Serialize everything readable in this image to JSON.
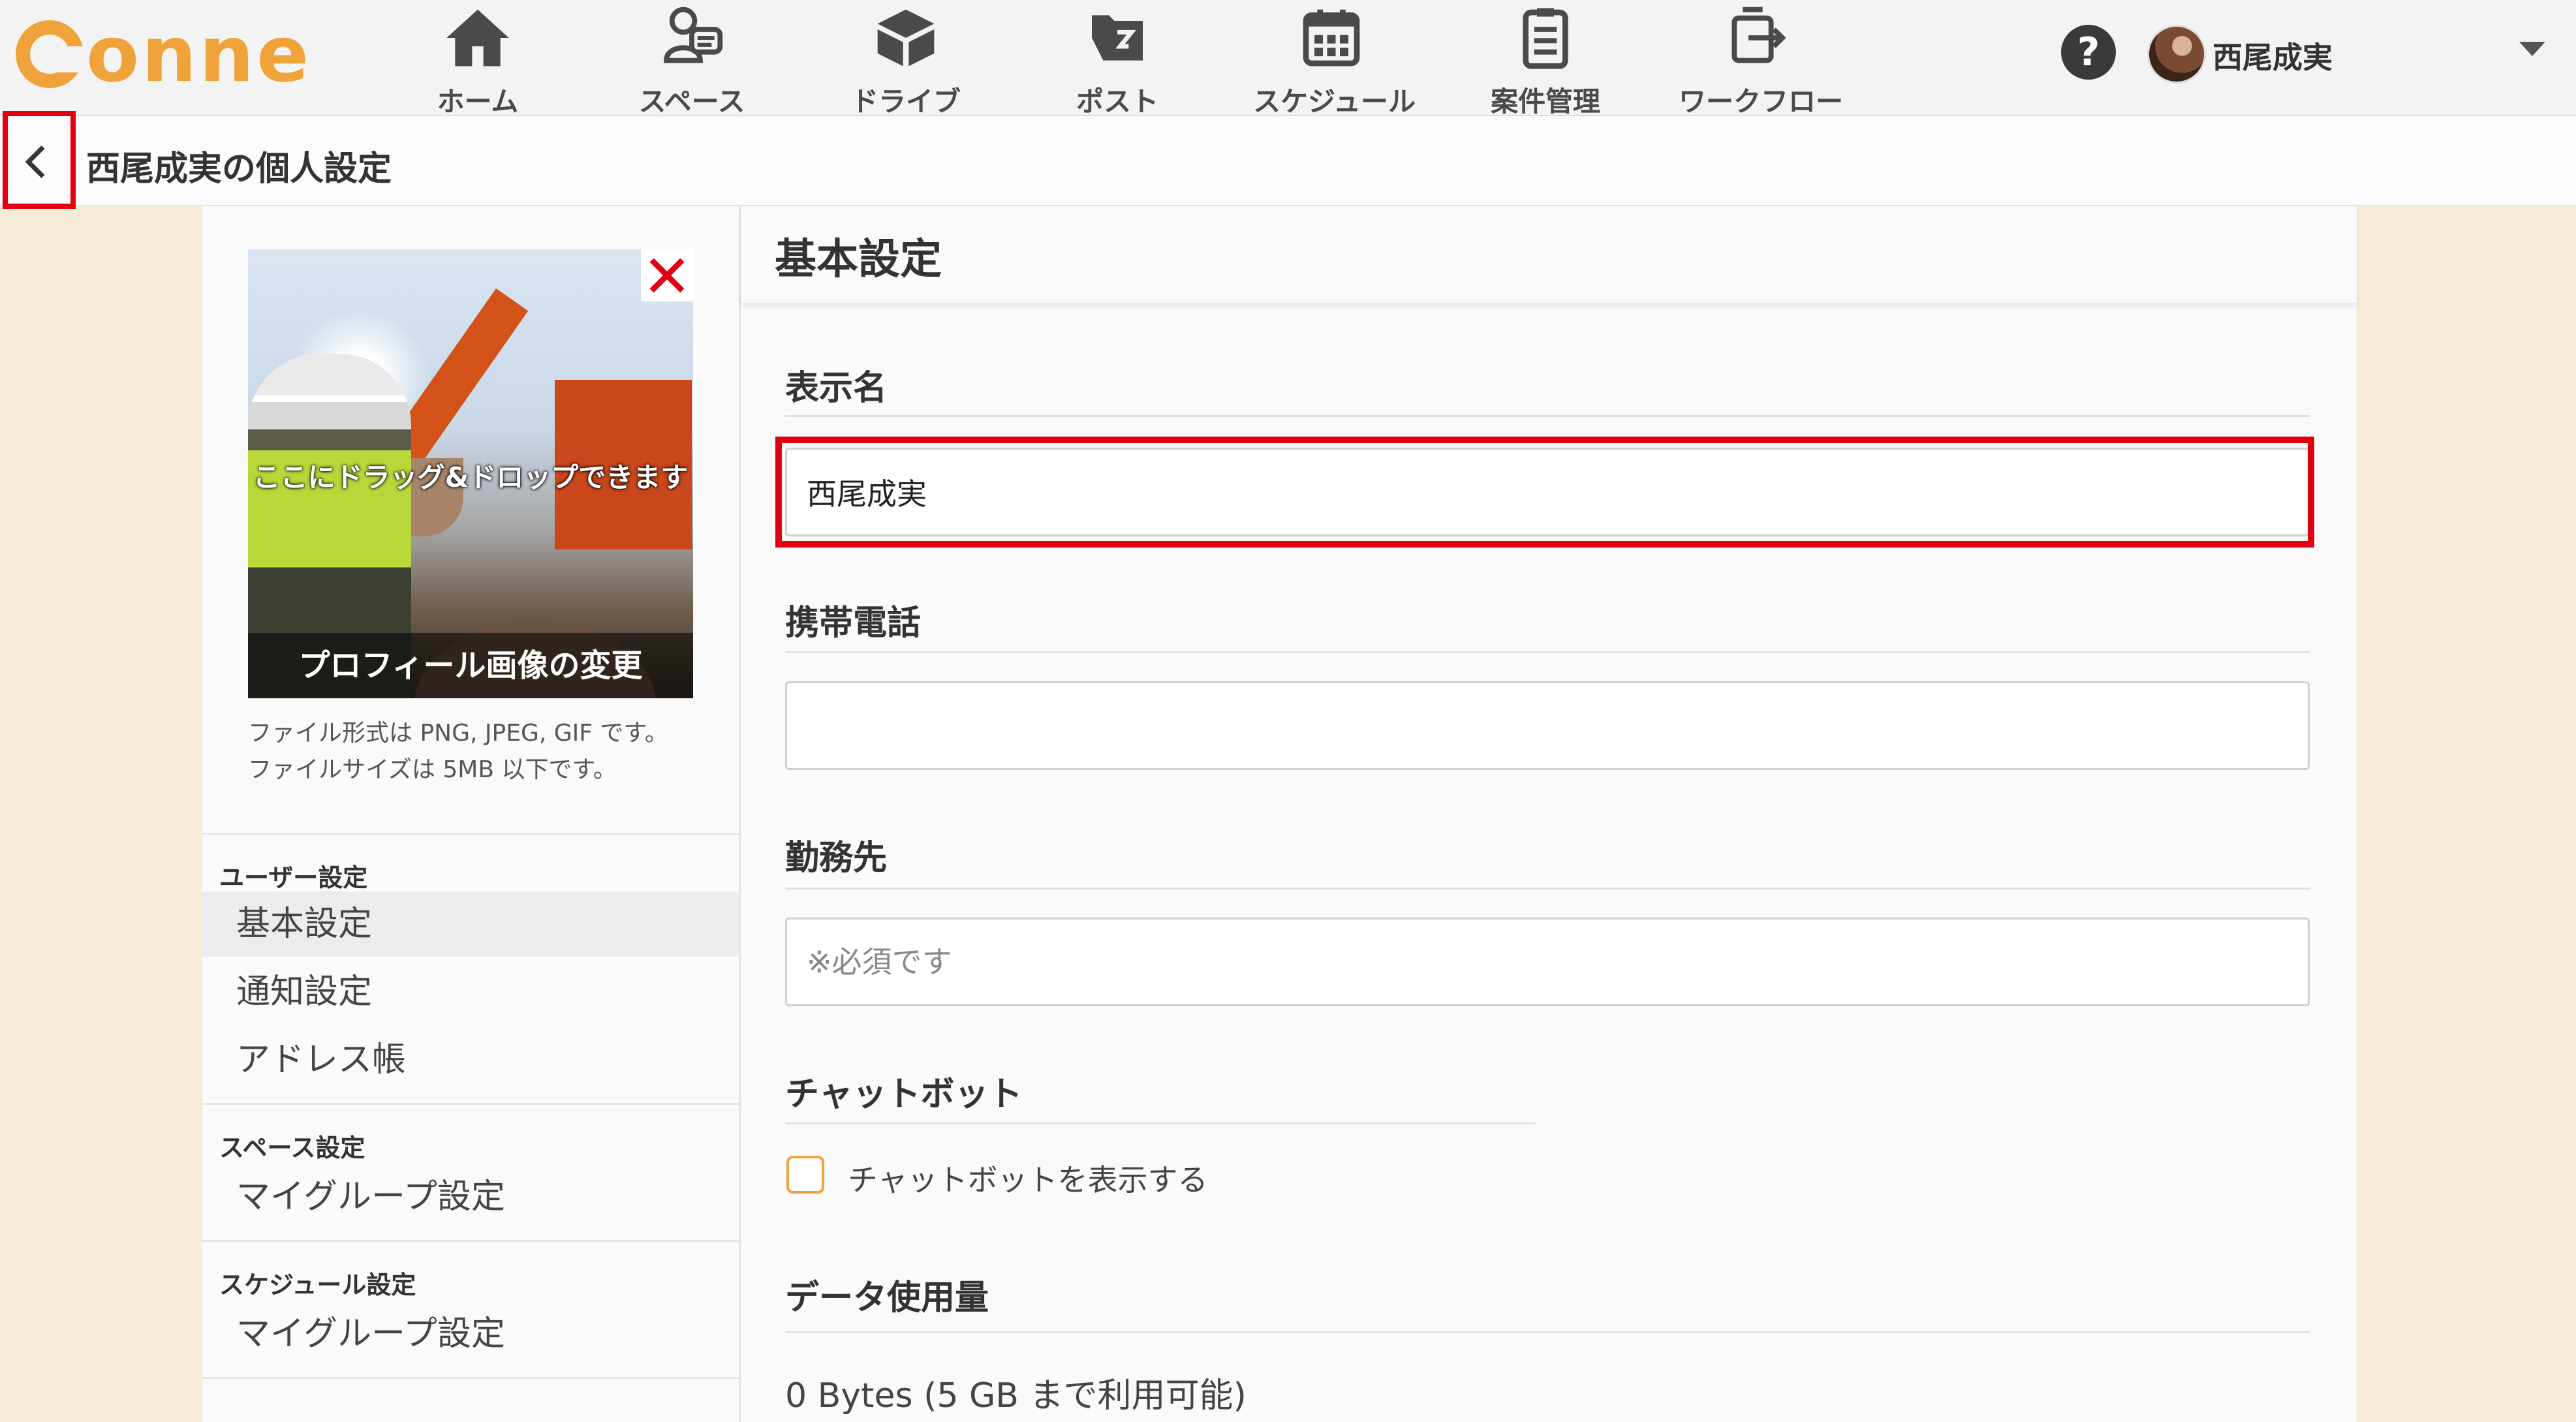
{
  "app": {
    "logo_text": "onne"
  },
  "nav": [
    {
      "label": "ホーム",
      "icon": "home-icon"
    },
    {
      "label": "スペース",
      "icon": "space-icon"
    },
    {
      "label": "ドライブ",
      "icon": "drive-icon"
    },
    {
      "label": "ポスト",
      "icon": "post-icon"
    },
    {
      "label": "スケジュール",
      "icon": "calendar-icon"
    },
    {
      "label": "案件管理",
      "icon": "clipboard-icon"
    },
    {
      "label": "ワークフロー",
      "icon": "workflow-icon"
    }
  ],
  "header": {
    "help_label": "?",
    "user_name": "西尾成実"
  },
  "page": {
    "title": "西尾成実の個人設定"
  },
  "profile": {
    "drop_hint": "ここにドラッグ&ドロップできます",
    "change_label": "プロフィール画像の変更",
    "file_note_1": "ファイル形式は PNG, JPEG, GIF です。",
    "file_note_2": "ファイルサイズは 5MB 以下です。"
  },
  "sidebar": {
    "user_section": "ユーザー設定",
    "user_items": [
      "基本設定",
      "通知設定",
      "アドレス帳"
    ],
    "space_section": "スペース設定",
    "space_items": [
      "マイグループ設定"
    ],
    "schedule_section": "スケジュール設定",
    "schedule_items": [
      "マイグループ設定"
    ]
  },
  "main": {
    "section_title": "基本設定",
    "display_name": {
      "label": "表示名",
      "value": "西尾成実"
    },
    "mobile_phone": {
      "label": "携帯電話",
      "value": ""
    },
    "workplace": {
      "label": "勤務先",
      "placeholder": "※必須です"
    },
    "chatbot": {
      "label": "チャットボット",
      "checkbox_label": "チャットボットを表示する",
      "checked": false
    },
    "data_usage": {
      "label": "データ使用量",
      "value": "0 Bytes (5 GB まで利用可能)"
    }
  },
  "colors": {
    "accent": "#f0a33a",
    "highlight": "#e0000f",
    "background": "#f6ebd6"
  }
}
